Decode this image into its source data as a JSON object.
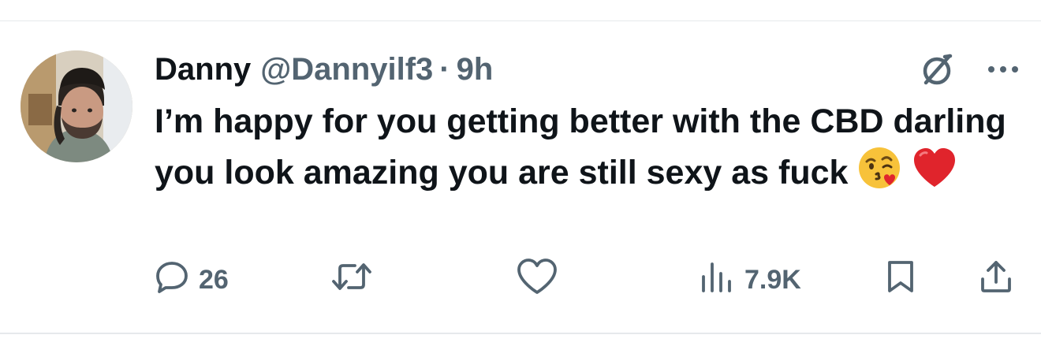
{
  "tweet": {
    "author": {
      "display_name": "Danny",
      "handle": "@Dannyilf3",
      "separator": "·",
      "time": "9h"
    },
    "text": "I’m happy for you getting better with the CBD darling you look amazing you are still sexy as fuck",
    "emojis": [
      "face-blowing-kiss-icon",
      "red-heart-icon"
    ],
    "stats": {
      "replies": "26",
      "views": "7.9K"
    }
  },
  "icons": {
    "grok": "grok-icon",
    "more": "more-icon",
    "reply": "reply-icon",
    "retweet": "retweet-icon",
    "like": "like-icon",
    "views": "views-icon",
    "bookmark": "bookmark-icon",
    "share": "share-icon"
  },
  "colors": {
    "text_primary": "#0f1419",
    "text_secondary": "#536471",
    "divider": "#e6e9ec",
    "heart_emoji": "#e0242c"
  }
}
